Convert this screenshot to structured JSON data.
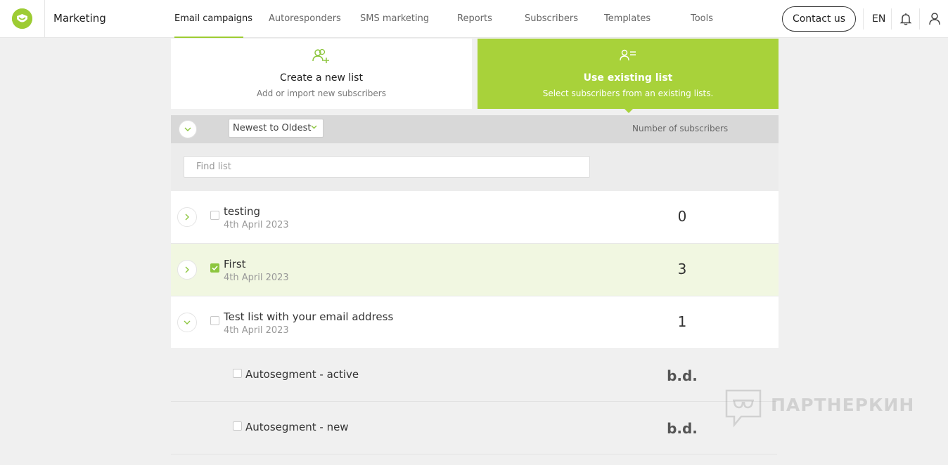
{
  "header": {
    "app_title": "Marketing",
    "nav": [
      {
        "label": "Email campaigns",
        "active": true
      },
      {
        "label": "Autoresponders"
      },
      {
        "label": "SMS marketing"
      },
      {
        "label": "Reports"
      },
      {
        "label": "Subscribers"
      },
      {
        "label": "Templates"
      },
      {
        "label": "Tools"
      }
    ],
    "contact_label": "Contact us",
    "language": "EN",
    "icons": [
      "logo-icon",
      "bell-icon",
      "user-icon"
    ]
  },
  "choices": {
    "new_list": {
      "title": "Create a new list",
      "subtitle": "Add or import new subscribers",
      "icon": "add-user-icon"
    },
    "existing_list": {
      "title": "Use existing list",
      "subtitle": "Select subscribers from an existing lists.",
      "icon": "user-list-icon",
      "selected": true
    }
  },
  "table": {
    "sort_value": "Newest to Oldest",
    "column_subscribers": "Number of subscribers",
    "search_placeholder": "Find list",
    "rows": [
      {
        "name": "testing",
        "date": "4th April 2023",
        "count": "0",
        "checked": false,
        "expanded": false
      },
      {
        "name": "First",
        "date": "4th April 2023",
        "count": "3",
        "checked": true,
        "expanded": false
      },
      {
        "name": "Test list with your email address",
        "date": "4th April 2023",
        "count": "1",
        "checked": false,
        "expanded": true
      }
    ],
    "subrows": [
      {
        "name": "Autosegment - active",
        "count": "b.d.",
        "checked": false
      },
      {
        "name": "Autosegment - new",
        "count": "b.d.",
        "checked": false
      }
    ]
  },
  "watermark": "ПАРТНЕРКИН",
  "colors": {
    "accent": "#a8d23a",
    "check": "#8dc63f",
    "selected_row": "#f1f7e1"
  }
}
